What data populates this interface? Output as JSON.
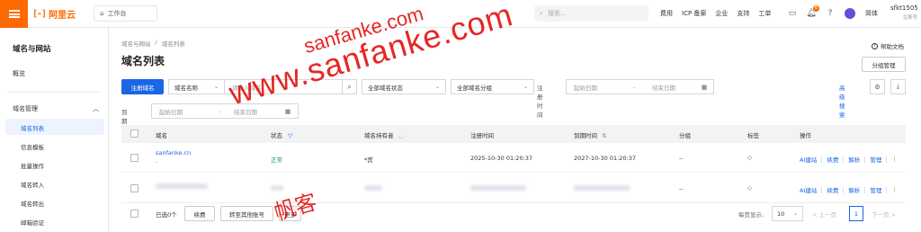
{
  "topbar": {
    "logo_mark": "[-]",
    "logo_text": "阿里云",
    "workspace_label": "工作台",
    "search_placeholder": "搜索...",
    "nav": [
      "费用",
      "ICP 备案",
      "企业",
      "支持",
      "工单"
    ],
    "notification_count": "6",
    "language": "简体",
    "account_name": "sfkt1505",
    "account_role": "主账号"
  },
  "sidebar": {
    "title": "域名与网站",
    "overview": "概览",
    "group": "域名管理",
    "items": [
      "域名列表",
      "信息模板",
      "批量操作",
      "域名转入",
      "域名转出",
      "邮箱验证"
    ]
  },
  "main": {
    "breadcrumb": [
      "域名与网站",
      "/",
      "域名列表"
    ],
    "title": "域名列表",
    "help": "帮助文档",
    "group_manage": "分组管理",
    "register_btn": "注册域名",
    "search_type": "域名名称",
    "search_placeholder": "请输入域名",
    "status_filter": "全部域名状态",
    "group_filter": "全部域名分组",
    "reg_time_label": "注册时间",
    "expire_time_label": "到期时间",
    "start_date": "起始日期",
    "end_date": "结束日期",
    "range_sep": "-",
    "advanced_search": "高级搜索"
  },
  "table": {
    "headers": [
      "域名",
      "状态",
      "域名持有者",
      "注册时间",
      "到期时间",
      "分组",
      "标签",
      "操作"
    ],
    "rows": [
      {
        "domain": "sanfanke.cn",
        "sub": "-",
        "status": "正常",
        "holder": "*宾",
        "reg_time": "2025-10-30 01:20:37",
        "expire_time": "2027-10-30 01:20:37",
        "group": "--"
      },
      {
        "group": "--"
      }
    ],
    "ops": [
      "AI建站",
      "续费",
      "解析",
      "管理"
    ]
  },
  "footer": {
    "selected": "已选0个",
    "renew": "续费",
    "transfer": "转至其他账号",
    "more": "更多",
    "page_size_label": "每页显示:",
    "page_size": "10",
    "prev": "< 上一页",
    "current_page": "1",
    "next": "下一页 >"
  },
  "watermark": {
    "url": "www.sanfanke.com",
    "small": "sanfanke.com",
    "cn": "帆客"
  },
  "colors": {
    "accent": "#ff6a00",
    "primary": "#1a66e4",
    "ok": "#1a9a4a",
    "watermark": "#e00000"
  }
}
